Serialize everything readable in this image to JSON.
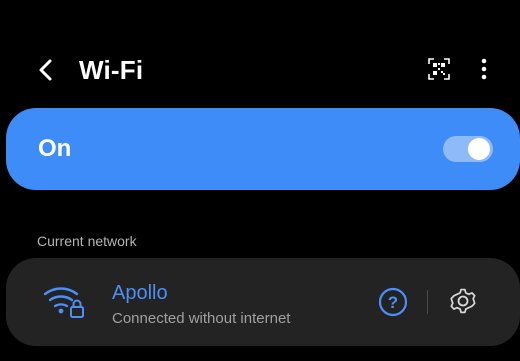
{
  "header": {
    "title": "Wi-Fi",
    "back_icon": "chevron-left-icon",
    "qr_icon": "qr-code-scan-icon",
    "more_icon": "more-vertical-icon"
  },
  "wifi_toggle": {
    "label": "On",
    "enabled": true,
    "accent_color": "#3e8cf7"
  },
  "current_network": {
    "section_label": "Current network",
    "name": "Apollo",
    "status": "Connected without internet",
    "signal_icon": "wifi-locked-icon",
    "help_icon": "question-circle-icon",
    "settings_icon": "gear-icon",
    "accent_color": "#4d8ff5"
  }
}
